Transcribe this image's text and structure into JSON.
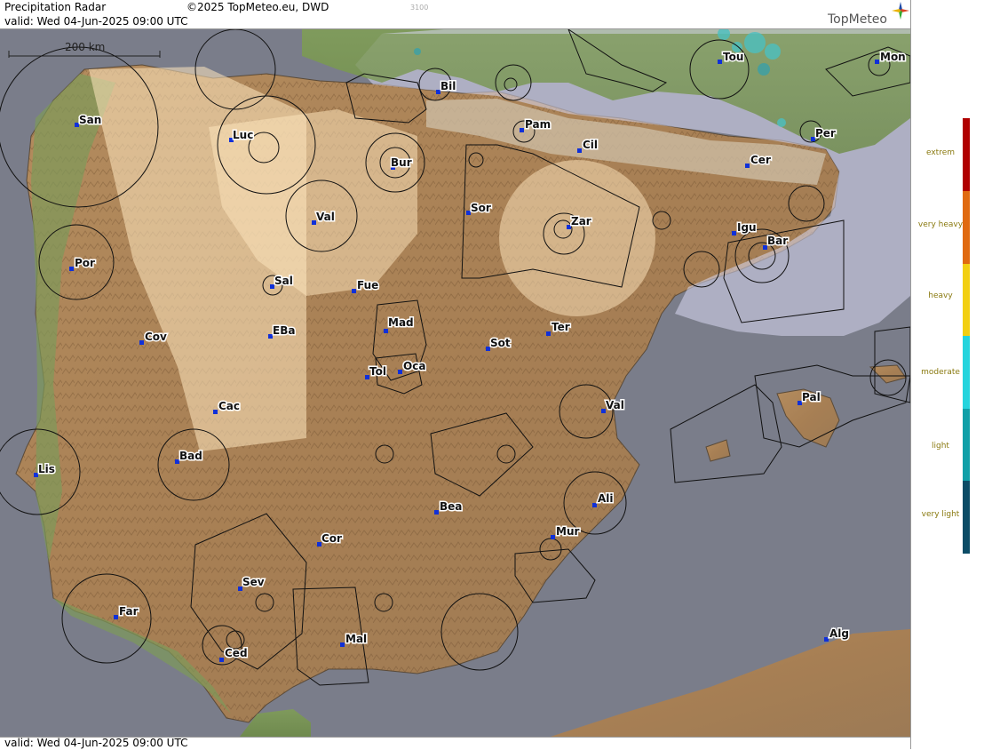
{
  "header": {
    "title": "Precipitation Radar",
    "copyright": "©2025 TopMeteo.eu, DWD",
    "valid_top": "valid:  Wed  04-Jun-2025 09:00 UTC",
    "small_code": "3100",
    "brand": "TopMeteo"
  },
  "footer": {
    "valid_bottom": "valid:  Wed  04-Jun-2025 09:00 UTC"
  },
  "scale_label": "200 km",
  "legend": {
    "labels": [
      "extrem",
      "very heavy",
      "heavy",
      "moderate",
      "light",
      "very light"
    ],
    "colors": [
      "#b00000",
      "#e06a10",
      "#f2cf12",
      "#25d4dd",
      "#10a0a8",
      "#0c4c66"
    ]
  },
  "cities": [
    {
      "name": "San"
    },
    {
      "name": "Luc"
    },
    {
      "name": "Bur"
    },
    {
      "name": "Bil"
    },
    {
      "name": "Pam"
    },
    {
      "name": "Cil"
    },
    {
      "name": "Tou"
    },
    {
      "name": "Mon"
    },
    {
      "name": "Per"
    },
    {
      "name": "Cer"
    },
    {
      "name": "Val"
    },
    {
      "name": "Sor"
    },
    {
      "name": "Zar"
    },
    {
      "name": "Igu"
    },
    {
      "name": "Bar"
    },
    {
      "name": "Por"
    },
    {
      "name": "Sal"
    },
    {
      "name": "Fue"
    },
    {
      "name": "Mad"
    },
    {
      "name": "Cov"
    },
    {
      "name": "EBa"
    },
    {
      "name": "Tol"
    },
    {
      "name": "Oca"
    },
    {
      "name": "Sot"
    },
    {
      "name": "Ter"
    },
    {
      "name": "Val"
    },
    {
      "name": "Pal"
    },
    {
      "name": "Cac"
    },
    {
      "name": "Lis"
    },
    {
      "name": "Bad"
    },
    {
      "name": "Bea"
    },
    {
      "name": "Ali"
    },
    {
      "name": "Cor"
    },
    {
      "name": "Mur"
    },
    {
      "name": "Sev"
    },
    {
      "name": "Far"
    },
    {
      "name": "Mal"
    },
    {
      "name": "Ced"
    },
    {
      "name": "Alg"
    }
  ]
}
